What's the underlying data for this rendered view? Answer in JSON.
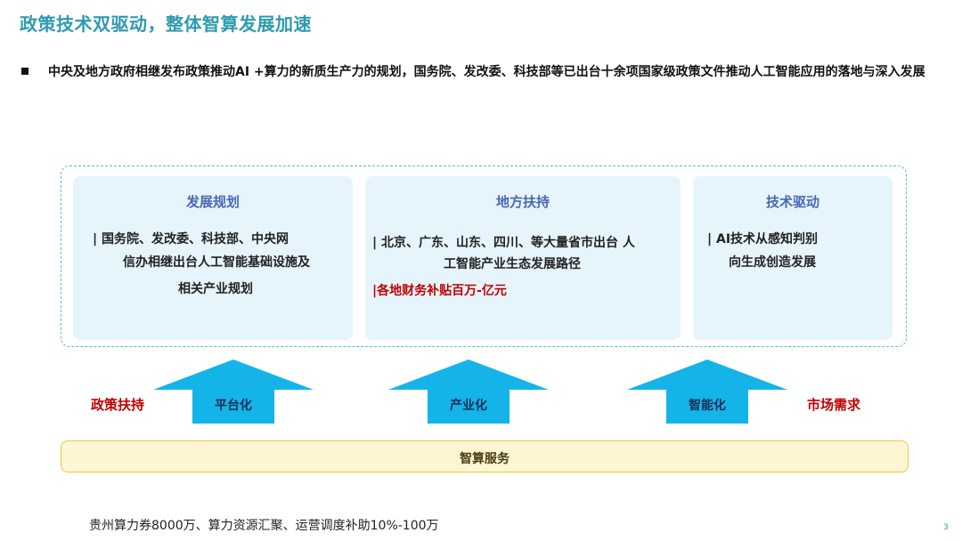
{
  "title": "政策技术双驱动，整体智算发展加速",
  "bullet": "中央及地方政府相继发布政策推动AI +算力的新质生产力的规划，国务院、发改委、科技部等已出台十余项国家级政策文件推动人工智能应用的落地与深入发展",
  "cards": [
    {
      "title": "发展规划",
      "lines": [
        "| 国务院、发改委、科技部、中央网",
        "信办相继出台人工智能基础设施及",
        "相关产业规划"
      ]
    },
    {
      "title": "地方扶持",
      "lines": [
        "| 北京、广东、山东、四川、等大量省市出台 人",
        "工智能产业生态发展路径",
        "|各地财务补贴百万-亿元"
      ]
    },
    {
      "title": "技术驱动",
      "lines": [
        "| AI技术从感知判别",
        "向生成创造发展"
      ]
    }
  ],
  "arrows": [
    "平台化",
    "产业化",
    "智能化"
  ],
  "left_label": "政策扶持",
  "right_label": "市场需求",
  "service": "智算服务",
  "footnote": "贵州算力券8000万、算力资源汇聚、运营调度补助10%-100万",
  "page_number": "3",
  "colors": {
    "title": "#2e9ab0",
    "card_bg": "#e6f4fb",
    "card_title": "#4a67b5",
    "arrow": "#14b4e8",
    "highlight_red": "#c00000",
    "service_bg": "#fdf6d2",
    "service_border": "#f0c64a"
  }
}
